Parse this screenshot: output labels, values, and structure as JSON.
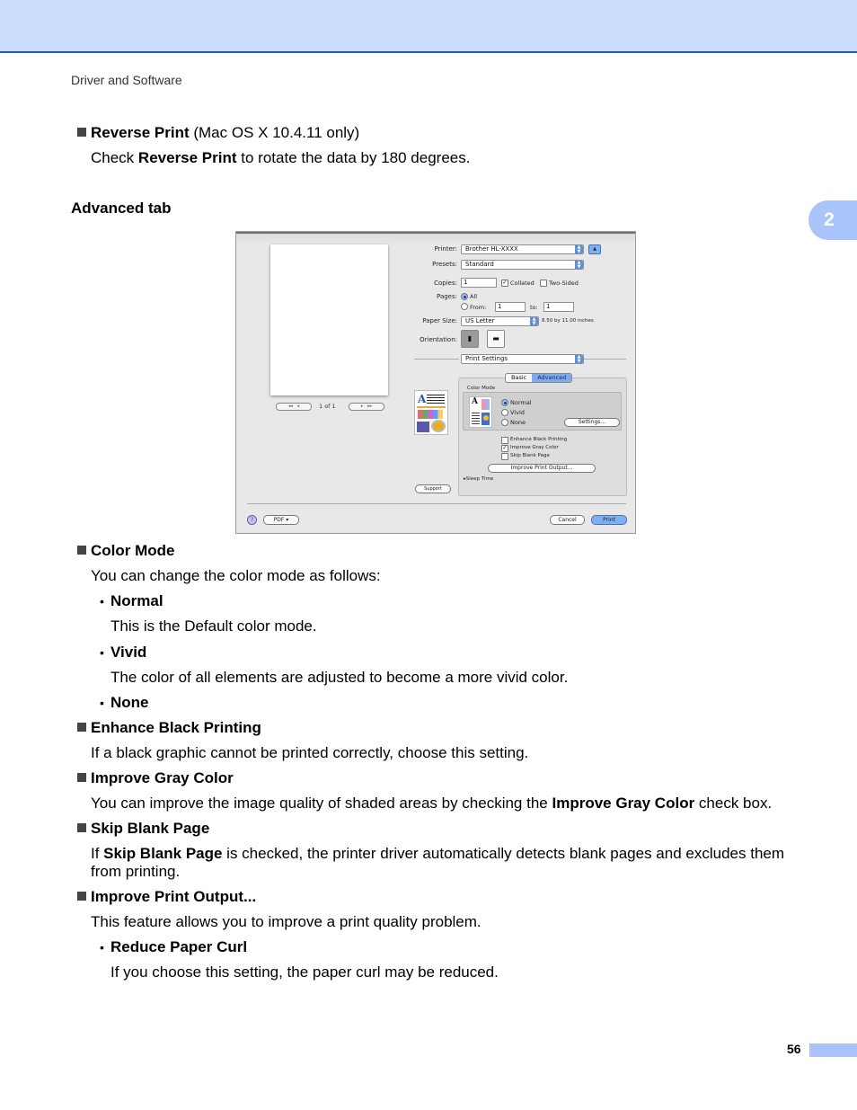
{
  "header": {
    "running_head": "Driver and Software",
    "chapter_number": "2",
    "page_number": "56",
    "accent_color": "#ccdcfd",
    "rule_color": "#1f57d8"
  },
  "intro": {
    "reverse_print": {
      "title": "Reverse Print",
      "title_suffix": " (Mac OS X 10.4.11 only)",
      "body_pre": "Check ",
      "body_bold": "Reverse Print",
      "body_post": " to rotate the data by 180 degrees."
    },
    "section_heading": "Advanced tab"
  },
  "dialog": {
    "page_count": "1 of 1",
    "printer_label": "Printer:",
    "printer_value": "Brother HL-XXXX",
    "presets_label": "Presets:",
    "presets_value": "Standard",
    "copies_label": "Copies:",
    "copies_value": "1",
    "collated_label": "Collated",
    "collated_checked": true,
    "two_sided_label": "Two-Sided",
    "two_sided_checked": false,
    "pages_label": "Pages:",
    "pages_all_label": "All",
    "pages_from_label": "From:",
    "pages_from_value": "1",
    "pages_to_label": "to:",
    "pages_to_value": "1",
    "paper_size_label": "Paper Size:",
    "paper_size_value": "US Letter",
    "paper_size_dims": "8.50 by 11.00 inches",
    "orientation_label": "Orientation:",
    "panel_popup_value": "Print Settings",
    "tabs": [
      {
        "label": "Basic",
        "active": false
      },
      {
        "label": "Advanced",
        "active": true
      }
    ],
    "color_mode_label": "Color Mode",
    "color_modes": [
      {
        "label": "Normal",
        "selected": true
      },
      {
        "label": "Vivid",
        "selected": false
      },
      {
        "label": "None",
        "selected": false
      }
    ],
    "settings_button": "Settings...",
    "checkboxes": [
      {
        "label": "Enhance Black Printing",
        "checked": false
      },
      {
        "label": "Improve Gray Color",
        "checked": true
      },
      {
        "label": "Skip Blank Page",
        "checked": false
      }
    ],
    "improve_output_button": "Improve Print Output...",
    "sleep_time_label": "Sleep Time",
    "support_button": "Support",
    "help_button": "?",
    "pdf_button": "PDF ▾",
    "cancel_button": "Cancel",
    "print_button": "Print"
  },
  "sections": {
    "color_mode": {
      "title": "Color Mode",
      "intro": "You can change the color mode as follows:",
      "items": [
        {
          "title": "Normal",
          "desc": "This is the Default color mode."
        },
        {
          "title": "Vivid",
          "desc": "The color of all elements are adjusted to become a more vivid color."
        },
        {
          "title": "None",
          "desc": ""
        }
      ]
    },
    "enhance_black": {
      "title": "Enhance Black Printing",
      "body": "If a black graphic cannot be printed correctly, choose this setting."
    },
    "improve_gray": {
      "title": "Improve Gray Color",
      "body_pre": "You can improve the image quality of shaded areas by checking the ",
      "body_bold": "Improve Gray Color",
      "body_post": " check box."
    },
    "skip_blank": {
      "title": "Skip Blank Page",
      "body_pre": "If ",
      "body_bold": "Skip Blank Page",
      "body_post": " is checked, the printer driver automatically detects blank pages and excludes them",
      "body_line2": "from printing."
    },
    "improve_output": {
      "title": "Improve Print Output...",
      "body": "This feature allows you to improve a print quality problem.",
      "items": [
        {
          "title": "Reduce Paper Curl",
          "desc": "If you choose this setting, the paper curl may be reduced."
        }
      ]
    }
  }
}
